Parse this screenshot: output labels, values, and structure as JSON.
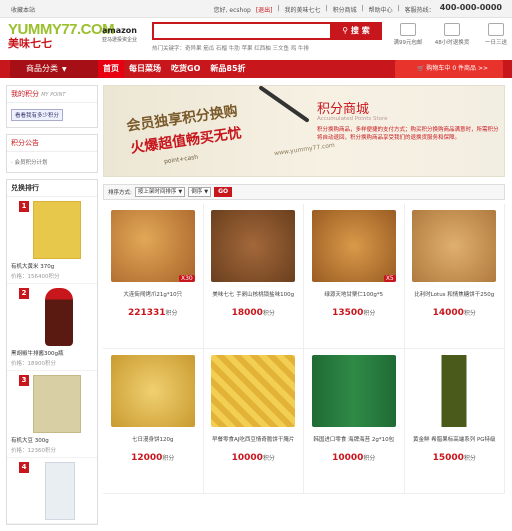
{
  "topbar": {
    "favorite": "收藏本站",
    "greeting": "您好, ecshop",
    "logout": "[退出]",
    "my_yummy": "我的美味七七",
    "points_mall": "积分商城",
    "help": "帮助中心",
    "hotline_label": "客服热线：",
    "hotline": "400-000-0000"
  },
  "logo": {
    "brand": "YUMMY77.COM",
    "cn": "美味七七"
  },
  "amazon": {
    "name": "amazon",
    "sub": "亚马逊投资企业"
  },
  "search": {
    "placeholder": "",
    "button": "搜 索",
    "hot_words": "热门关键字：奇异果  筋瓜  石榴  牛肋  苹果  红西柚  三文鱼  鸡  牛排"
  },
  "services": [
    {
      "icon": "gift-icon",
      "label": "满99元包邮"
    },
    {
      "icon": "return-icon",
      "label": "48小时退换货"
    },
    {
      "icon": "delivery-icon",
      "label": "一日三送"
    }
  ],
  "nav": {
    "category": "商品分类",
    "items": [
      "首页",
      "每日菜场",
      "吃货GO",
      "新品85折"
    ],
    "cart": "购物车中 0 件商品"
  },
  "sidebar": {
    "my_points_title": "我的积分",
    "my_points_en": "MY POINT",
    "login_btn": "看看我有多少积分",
    "notice_title": "积分公告",
    "notice_item": "会员积分计划",
    "rank_title": "兑换排行",
    "rank": [
      {
        "num": "1",
        "name": "有机大黄米 370g",
        "price": "价格：156400积分"
      },
      {
        "num": "2",
        "name": "黑胡椒牛排酱300g瓶",
        "price": "价格：18900积分"
      },
      {
        "num": "3",
        "name": "有机大豆 300g",
        "price": "价格：12360积分"
      },
      {
        "num": "4",
        "name": "",
        "price": ""
      }
    ]
  },
  "banner": {
    "line1": "会员独享积分换购",
    "line2": "火爆超值畅买无忧",
    "line3": "point+cash",
    "site": "www.yummy77.com",
    "title": "积分商城",
    "subtitle": "Accumulated Points Store",
    "desc": "积分换购商品，多样便捷的支付方式；购买积分换购商品满意时，所需积分将自动退回，积分换购商品享受我们的退换货服务和保障。"
  },
  "sortbar": {
    "label": "排序方式:",
    "sort": "按上架时间排序",
    "order": "倒序",
    "go": "GO"
  },
  "products": [
    {
      "name": "大连街闯烤爪21g*10只",
      "points": "221331",
      "unit": "积分",
      "badge": "X30",
      "color": "#c98a3a"
    },
    {
      "name": "美味七七 手剥山核桃锁盐味100g",
      "points": "18000",
      "unit": "积分",
      "badge": "",
      "color": "#8b5a34"
    },
    {
      "name": "绿源天地甘栗仁100g*5",
      "points": "13500",
      "unit": "积分",
      "badge": "X5",
      "color": "#b5772f"
    },
    {
      "name": "比利时Lotus 和情焦糖饼干250g",
      "points": "14000",
      "unit": "积分",
      "badge": "",
      "color": "#c9945a"
    },
    {
      "name": "七日漫身饼120g",
      "points": "12000",
      "unit": "积分",
      "badge": "",
      "color": "#d9b55a"
    },
    {
      "name": "早餐零食AJ吃西豆情奇脆饼干腌片",
      "points": "10000",
      "unit": "积分",
      "badge": "",
      "color": "#e8c24a"
    },
    {
      "name": "韩国进口零食 海牌海苔 2g*10包",
      "points": "10000",
      "unit": "积分",
      "badge": "",
      "color": "#2f7a3a"
    },
    {
      "name": "黄金鲜 希腊果标高端系列 PG特级",
      "points": "15000",
      "unit": "积分",
      "badge": "",
      "color": "#6b7a2a"
    }
  ]
}
